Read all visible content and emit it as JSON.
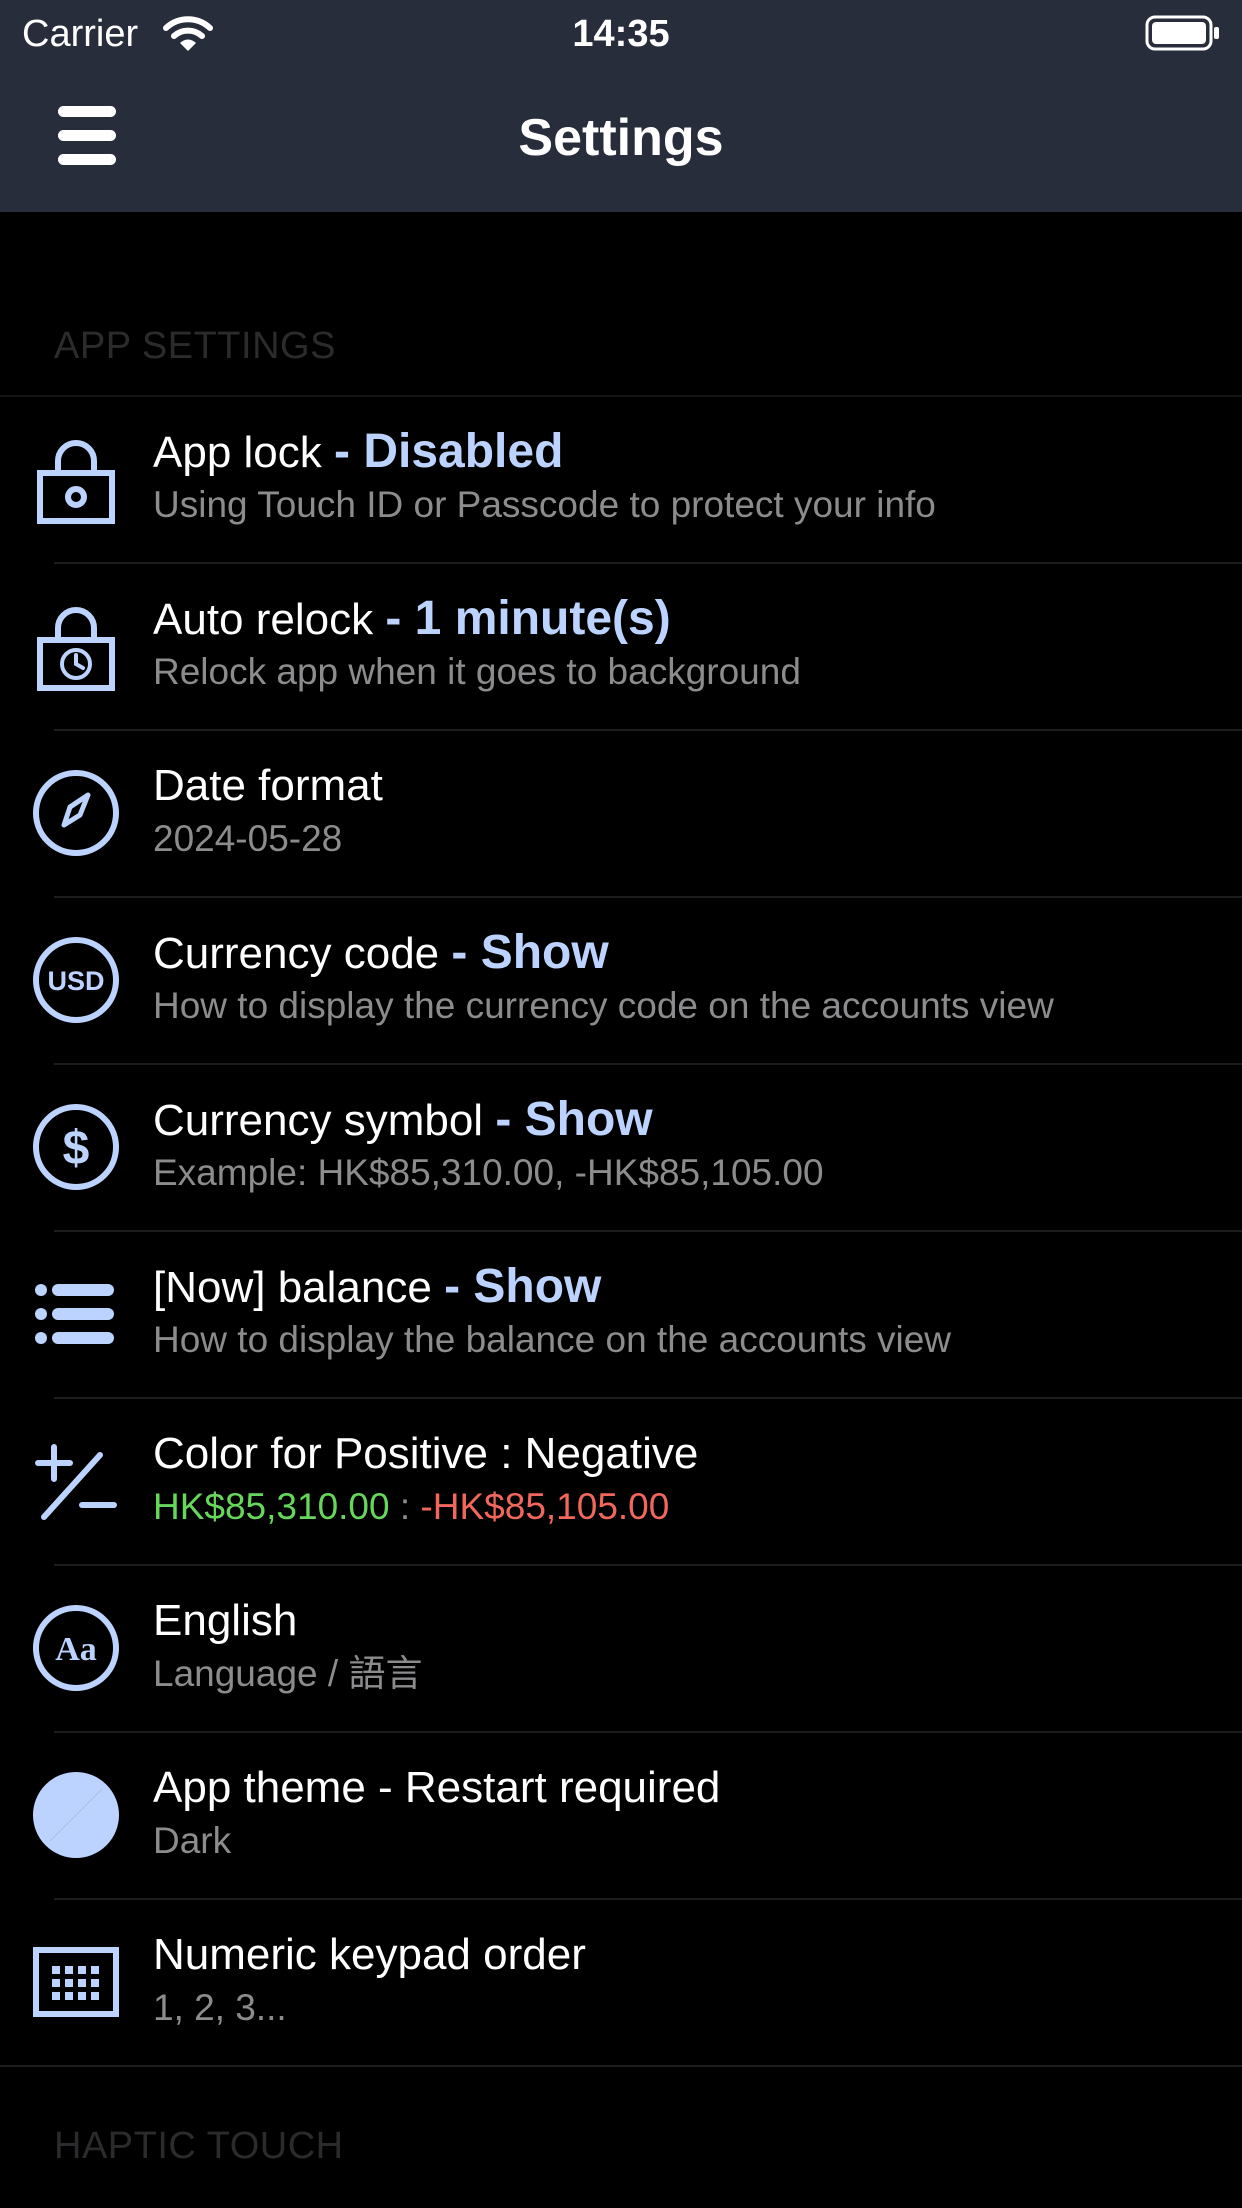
{
  "status_bar": {
    "carrier": "Carrier",
    "time": "14:35"
  },
  "nav": {
    "title": "Settings"
  },
  "sections": [
    {
      "header": "APP SETTINGS"
    },
    {
      "header": "HAPTIC TOUCH"
    }
  ],
  "colors": {
    "nav_background": "#272d3a",
    "accent": "#bdd3ff",
    "positive": "#67d75c",
    "negative": "#f2675c",
    "subtitle": "#8c8c8e"
  },
  "settings": [
    {
      "icon": "lock-icon",
      "title": "App lock",
      "value": "- Disabled",
      "subtitle": "Using Touch ID or Passcode to protect your info"
    },
    {
      "icon": "lock-clock-icon",
      "title": "Auto relock",
      "value": "- 1 minute(s)",
      "subtitle": "Relock app when it goes to background"
    },
    {
      "icon": "compass-icon",
      "title": "Date format",
      "value": "",
      "subtitle": "2024-05-28"
    },
    {
      "icon": "usd-icon",
      "title": "Currency code",
      "value": "- Show",
      "subtitle": "How to display the currency code on the accounts view"
    },
    {
      "icon": "dollar-icon",
      "title": "Currency symbol",
      "value": "- Show",
      "subtitle": "Example: HK$85,310.00, -HK$85,105.00"
    },
    {
      "icon": "list-icon",
      "title": "[Now] balance",
      "value": "- Show",
      "subtitle": "How to display the balance on the accounts view"
    },
    {
      "icon": "plus-minus-icon",
      "title": "Color for Positive : Negative",
      "value": "",
      "subtitle_positive": "HK$85,310.00",
      "subtitle_separator": " : ",
      "subtitle_negative": "-HK$85,105.00"
    },
    {
      "icon": "language-icon",
      "title": "English",
      "value": "",
      "subtitle": "Language / 語言"
    },
    {
      "icon": "theme-icon",
      "title": "App theme - Restart required",
      "value": "",
      "subtitle": "Dark"
    },
    {
      "icon": "keypad-icon",
      "title": "Numeric keypad order",
      "value": "",
      "subtitle": "1, 2, 3..."
    }
  ]
}
